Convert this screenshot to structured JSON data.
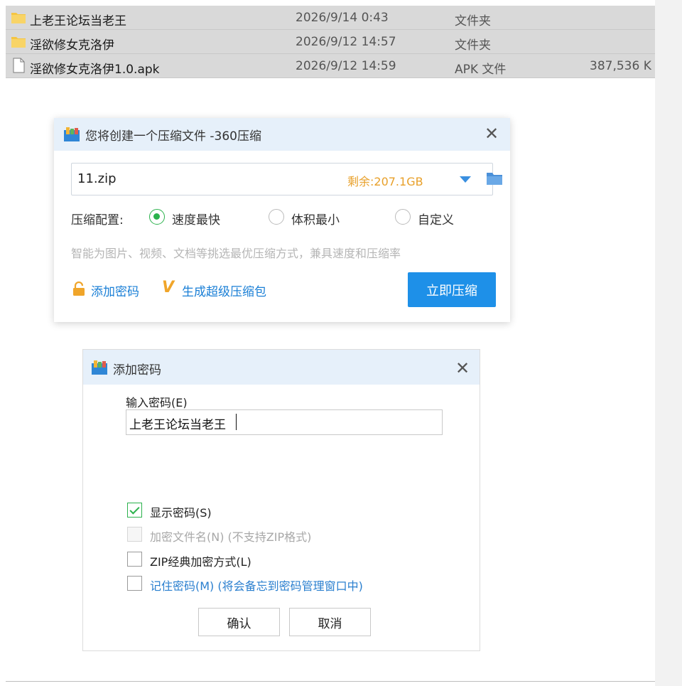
{
  "explorer": {
    "files": [
      {
        "icon": "folder-icon",
        "name": "上老王论坛当老王",
        "date": "2026/9/14 0:43",
        "type": "文件夹",
        "size": ""
      },
      {
        "icon": "folder-icon",
        "name": "淫欲修女克洛伊",
        "date": "2026/9/12 14:57",
        "type": "文件夹",
        "size": ""
      },
      {
        "icon": "file-icon",
        "name": "淫欲修女克洛伊1.0.apk",
        "date": "2026/9/12 14:59",
        "type": "APK 文件",
        "size": "387,536 K"
      }
    ]
  },
  "compress_dialog": {
    "title": "您将创建一个压缩文件 -360压缩",
    "filename": "11.zip",
    "free_space": "剩余:207.1GB",
    "config_label": "压缩配置:",
    "options": [
      "速度最快",
      "体积最小",
      "自定义"
    ],
    "selected_option": "速度最快",
    "hint": "智能为图片、视频、文档等挑选最优压缩方式，兼具速度和压缩率",
    "add_password_link": "添加密码",
    "super_compress_link": "生成超级压缩包",
    "compress_button": "立即压缩",
    "accent_color": "#1e90e8"
  },
  "password_dialog": {
    "title": "添加密码",
    "input_label": "输入密码(E)",
    "password_value": "上老王论坛当老王",
    "checkboxes": [
      {
        "label": "显示密码(S)",
        "checked": true,
        "enabled": true
      },
      {
        "label": "加密文件名(N) (不支持ZIP格式)",
        "checked": false,
        "enabled": false
      },
      {
        "label": "ZIP经典加密方式(L)",
        "checked": false,
        "enabled": true
      },
      {
        "label": "记住密码(M) (将会备忘到密码管理窗口中)",
        "checked": false,
        "enabled": true
      }
    ],
    "ok_button": "确认",
    "cancel_button": "取消"
  }
}
